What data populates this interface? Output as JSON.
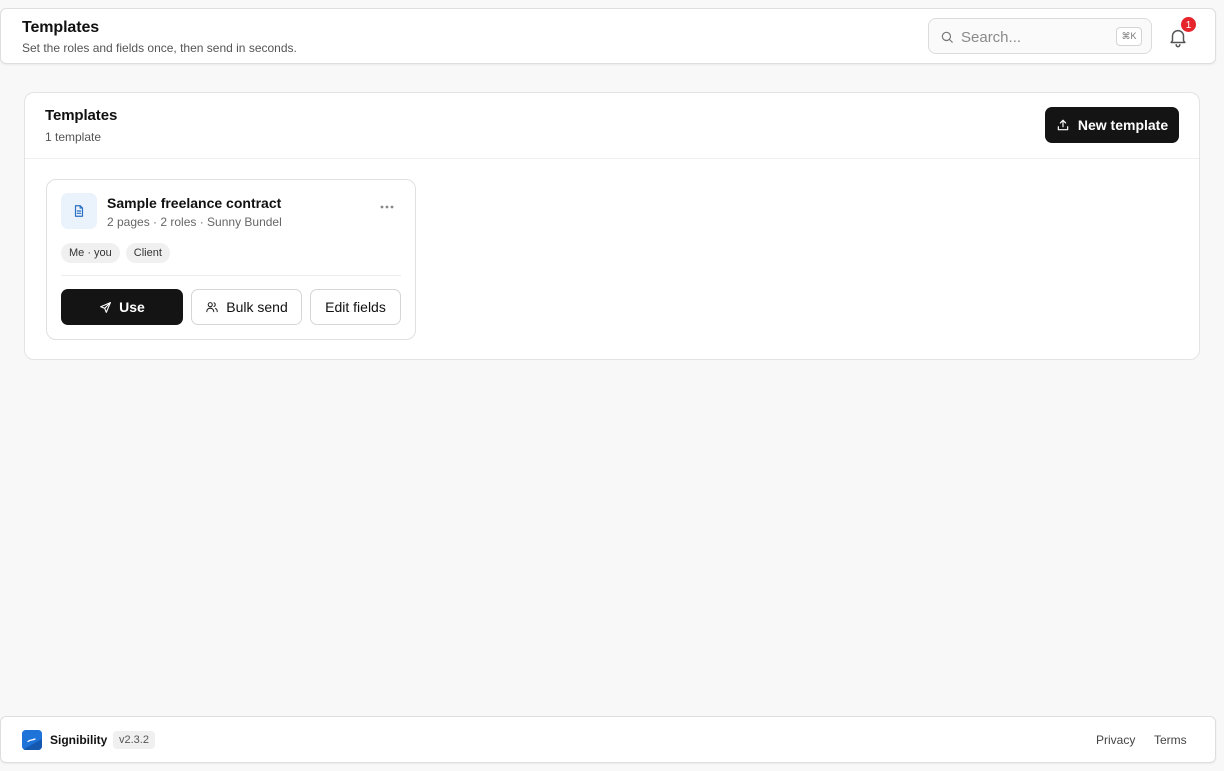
{
  "header": {
    "title": "Templates",
    "subtitle": "Set the roles and fields once, then send in seconds.",
    "search": {
      "placeholder": "Search...",
      "shortcut": "⌘K"
    },
    "notifications": {
      "count": "1"
    }
  },
  "panel": {
    "title": "Templates",
    "count_label": "1 template",
    "new_button_label": "New template"
  },
  "templates": [
    {
      "name": "Sample freelance contract",
      "meta": "2 pages · 2 roles · Sunny Bundel",
      "roles": [
        "Me · you",
        "Client"
      ],
      "actions": {
        "use": "Use",
        "bulk_send": "Bulk send",
        "edit_fields": "Edit fields"
      }
    }
  ],
  "footer": {
    "brand": "Signibility",
    "version": "v2.3.2",
    "links": [
      "Privacy",
      "Terms"
    ]
  },
  "colors": {
    "primary_button": "#141414",
    "badge": "#e5242b",
    "brand_logo": "#1e73d8",
    "doc_icon_bg": "#eaf2fb"
  },
  "icons": {
    "search": "search-icon",
    "bell": "bell-icon",
    "upload": "upload-icon",
    "document": "document-icon",
    "more": "more-horizontal-icon",
    "send": "send-icon",
    "users": "users-icon",
    "logo": "signibility-logo"
  }
}
